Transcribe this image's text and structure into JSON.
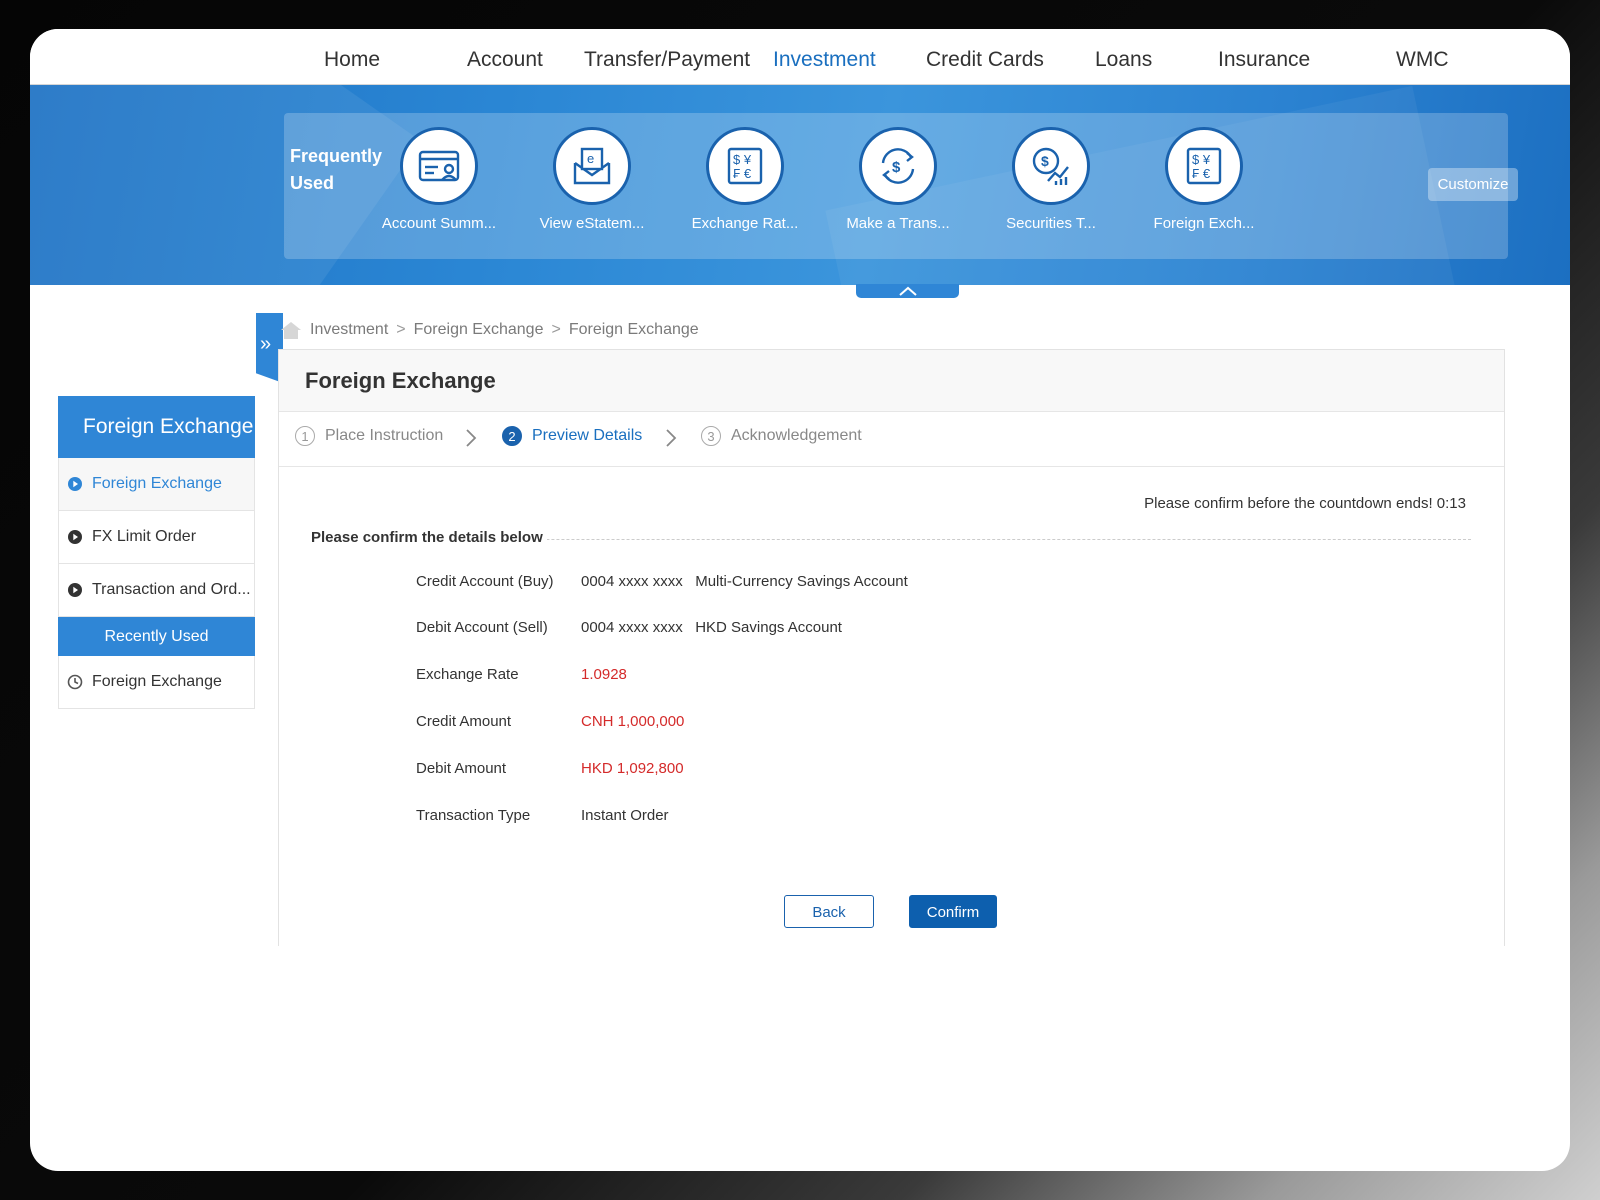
{
  "nav": {
    "items": [
      {
        "label": "Home"
      },
      {
        "label": "Account"
      },
      {
        "label": "Transfer/Payment"
      },
      {
        "label": "Investment"
      },
      {
        "label": "Credit Cards"
      },
      {
        "label": "Loans"
      },
      {
        "label": "Insurance"
      },
      {
        "label": "WMC"
      }
    ],
    "active": "Investment"
  },
  "frequently_used": {
    "title": "Frequently Used",
    "items": [
      {
        "label": "Account Summ...",
        "icon": "account-summary-icon"
      },
      {
        "label": "View eStatem...",
        "icon": "estatement-icon"
      },
      {
        "label": "Exchange Rat...",
        "icon": "currency-icon"
      },
      {
        "label": "Make a Trans...",
        "icon": "transfer-icon"
      },
      {
        "label": "Securities T...",
        "icon": "securities-chart-icon"
      },
      {
        "label": "Foreign Exch...",
        "icon": "currency-icon"
      }
    ],
    "customize_label": "Customize"
  },
  "sidebar": {
    "title": "Foreign Exchange",
    "items": [
      {
        "label": "Foreign Exchange",
        "active": true
      },
      {
        "label": "FX Limit Order"
      },
      {
        "label": "Transaction and Ord..."
      }
    ],
    "recent_title": "Recently Used",
    "recent_items": [
      {
        "label": "Foreign Exchange"
      }
    ]
  },
  "breadcrumb": {
    "items": [
      "Investment",
      "Foreign Exchange",
      "Foreign Exchange"
    ],
    "separator": ">"
  },
  "main": {
    "title": "Foreign Exchange",
    "steps": [
      {
        "num": "1",
        "label": "Place Instruction"
      },
      {
        "num": "2",
        "label": "Preview Details",
        "active": true
      },
      {
        "num": "3",
        "label": "Acknowledgement"
      }
    ],
    "countdown": "Please confirm before the countdown ends! 0:13",
    "section_title": "Please confirm the details below",
    "details": [
      {
        "label": "Credit Account (Buy)",
        "value": "0004 xxxx xxxx   Multi-Currency Savings Account"
      },
      {
        "label": "Debit Account (Sell)",
        "value": "0004 xxxx xxxx   HKD Savings Account"
      },
      {
        "label": "Exchange Rate",
        "value": "1.0928",
        "highlight": true
      },
      {
        "label": "Credit Amount",
        "value": "CNH 1,000,000",
        "highlight": true
      },
      {
        "label": "Debit Amount",
        "value": "HKD 1,092,800",
        "highlight": true
      },
      {
        "label": "Transaction Type",
        "value": "Instant Order"
      }
    ],
    "back_label": "Back",
    "confirm_label": "Confirm"
  },
  "colors": {
    "brand_blue": "#2f86d6",
    "dark_blue": "#0d5fae",
    "highlight_red": "#d42a2a"
  }
}
